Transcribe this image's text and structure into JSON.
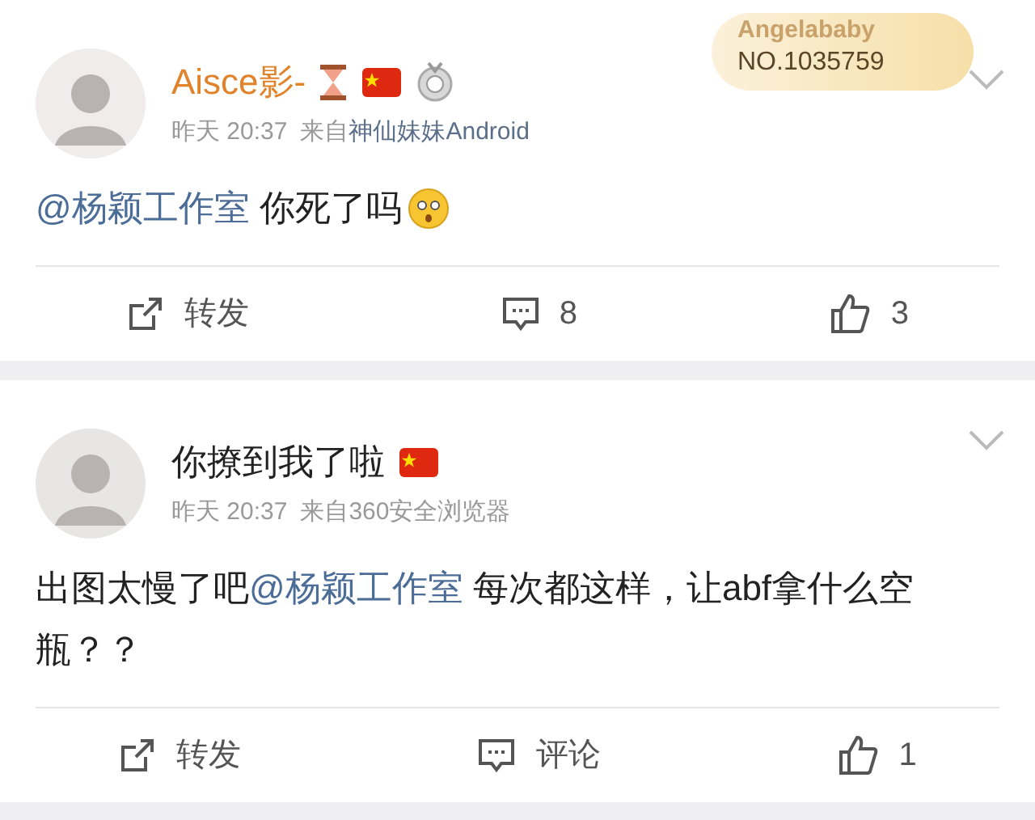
{
  "posts": [
    {
      "author": {
        "name": "Aisce影-",
        "vip": true
      },
      "badge_icons": [
        {
          "kind": "hourglass"
        },
        {
          "kind": "flag"
        },
        {
          "kind": "medal"
        }
      ],
      "fan_badge": {
        "title": "Angelababy",
        "number": "NO.1035759"
      },
      "time": "昨天 20:37",
      "source_label": "来自",
      "source": "神仙妹妹Android",
      "source_link": true,
      "body": [
        {
          "kind": "mention",
          "text": "@杨颖工作室"
        },
        {
          "kind": "text",
          "text": " 你死了吗"
        },
        {
          "kind": "emoji"
        }
      ],
      "actions": [
        {
          "kind": "repost",
          "label": "转发"
        },
        {
          "kind": "comment",
          "label": "8"
        },
        {
          "kind": "like",
          "label": "3"
        }
      ]
    },
    {
      "author": {
        "name": "你撩到我了啦",
        "vip": false
      },
      "badge_icons": [
        {
          "kind": "flag"
        }
      ],
      "time": "昨天 20:37",
      "source_label": "来自",
      "source": "360安全浏览器",
      "source_link": false,
      "body": [
        {
          "kind": "text",
          "text": "出图太慢了吧"
        },
        {
          "kind": "mention",
          "text": "@杨颖工作室"
        },
        {
          "kind": "text",
          "text": " 每次都这样，让abf拿什么空瓶？？"
        }
      ],
      "actions": [
        {
          "kind": "repost",
          "label": "转发"
        },
        {
          "kind": "comment",
          "label": "评论"
        },
        {
          "kind": "like",
          "label": "1"
        }
      ]
    }
  ]
}
